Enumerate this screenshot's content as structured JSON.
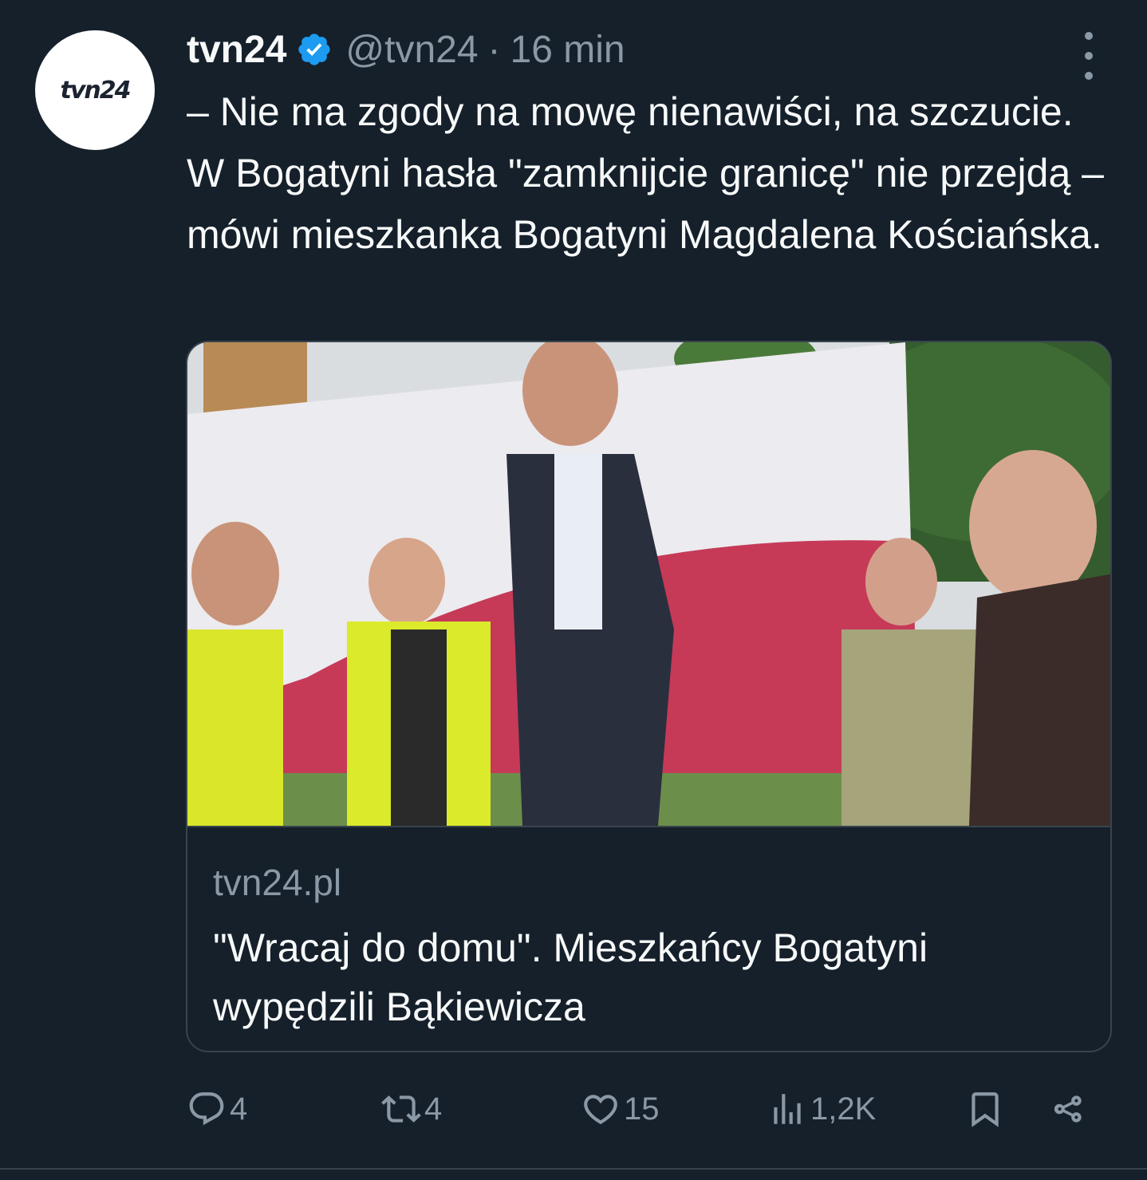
{
  "tweet": {
    "avatar_logo": "tvn24",
    "display_name": "tvn24",
    "handle": "@tvn24",
    "separator": "·",
    "time": "16 min",
    "text": "– Nie ma zgody na mowę nienawiści, na szczucie. W Bogatyni hasła \"zamknijcie granicę\" nie przejdą – mówi mieszkanka Bogatyni Magdalena Kościańska."
  },
  "card": {
    "domain": "tvn24.pl",
    "title": "\"Wracaj do domu\". Mieszkańcy Bogatyni wypędzili Bąkiewicza"
  },
  "actions": {
    "replies": "4",
    "reposts": "4",
    "likes": "15",
    "views": "1,2K"
  },
  "colors": {
    "background": "#15202b",
    "text": "#f7f9f9",
    "secondary": "#8b98a5",
    "verified": "#1d9bf0",
    "border": "#38444d"
  }
}
